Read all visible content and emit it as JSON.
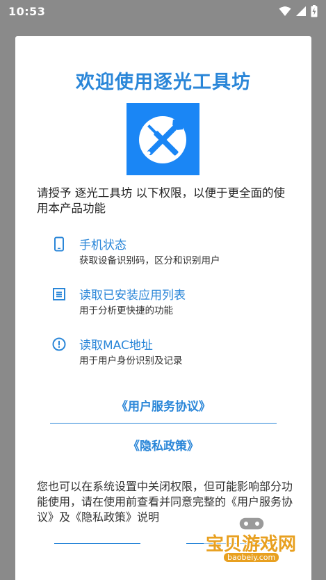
{
  "status_bar": {
    "time": "10:53"
  },
  "dialog": {
    "title": "欢迎使用逐光工具坊",
    "intro": "请授予 逐光工具坊 以下权限，以便于更全面的使用本产品功能",
    "permissions": [
      {
        "icon": "phone-icon",
        "title": "手机状态",
        "desc": "获取设备识别码，区分和识别用户"
      },
      {
        "icon": "list-icon",
        "title": "读取已安装应用列表",
        "desc": "用于分析更快捷的功能"
      },
      {
        "icon": "info-icon",
        "title": "读取MAC地址",
        "desc": "用于用户身份识别及记录"
      }
    ],
    "user_agreement_link": "《用户服务协议》",
    "privacy_policy_link": "《隐私政策》",
    "footer_note": "您也可以在系统设置中关闭权限，但可能影响部分功能使用，请在使用前查看并同意完整的《用户服务协议》及《隐私政策》说明"
  },
  "watermark": {
    "text": "宝贝游戏网",
    "url": "baobeiy.com"
  },
  "colors": {
    "accent": "#2a86d8",
    "logo_bg": "#1a86f5",
    "overlay": "#8a8a8a",
    "watermark": "#e8a020"
  }
}
